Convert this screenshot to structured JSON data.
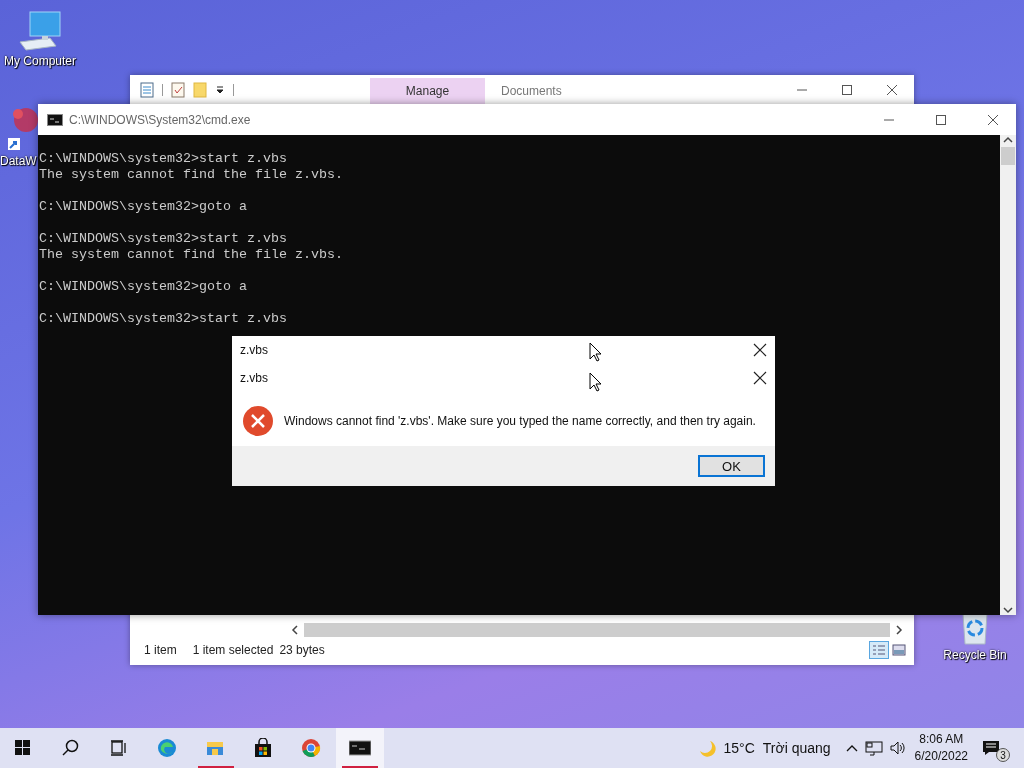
{
  "desktop_icons": [
    {
      "kind": "computer",
      "label": "My Computer"
    },
    {
      "kind": "app",
      "label": "DataW"
    },
    {
      "kind": "recycle",
      "label": "Recycle Bin"
    }
  ],
  "explorer": {
    "tabs": [
      {
        "label": "Manage",
        "selected": true
      },
      {
        "label": "Documents",
        "selected": false
      }
    ],
    "status_bar": [
      "1 item",
      "1 item selected",
      "23 bytes"
    ]
  },
  "cmd": {
    "title": "C:\\WINDOWS\\System32\\cmd.exe",
    "blocks": [
      [
        "C:\\WINDOWS\\system32>start z.vbs",
        "The system cannot find the file z.vbs."
      ],
      [
        "C:\\WINDOWS\\system32>goto a"
      ],
      [
        "C:\\WINDOWS\\system32>start z.vbs",
        "The system cannot find the file z.vbs."
      ],
      [
        "C:\\WINDOWS\\system32>goto a"
      ],
      [
        "C:\\WINDOWS\\system32>start z.vbs"
      ]
    ]
  },
  "dialog": {
    "titles": [
      "z.vbs",
      "z.vbs"
    ],
    "message": "Windows cannot find 'z.vbs'. Make sure you typed the name correctly, and then try again.",
    "button": "OK"
  },
  "taskbar": {
    "apps": [
      {
        "kind": "start",
        "running": false,
        "selected": false
      },
      {
        "kind": "search",
        "running": false,
        "selected": false
      },
      {
        "kind": "taskview",
        "running": false,
        "selected": false
      },
      {
        "kind": "edge",
        "running": false,
        "selected": false
      },
      {
        "kind": "explorer",
        "running": true,
        "selected": false
      },
      {
        "kind": "store",
        "running": false,
        "selected": false
      },
      {
        "kind": "chrome",
        "running": false,
        "selected": false
      },
      {
        "kind": "cmd",
        "running": true,
        "selected": true
      }
    ],
    "weather": {
      "temperature": "15°C",
      "condition": "Trời quang"
    },
    "clock": {
      "time": "8:06 AM",
      "date": "6/20/2022"
    },
    "notifications": {
      "count": "3"
    }
  }
}
